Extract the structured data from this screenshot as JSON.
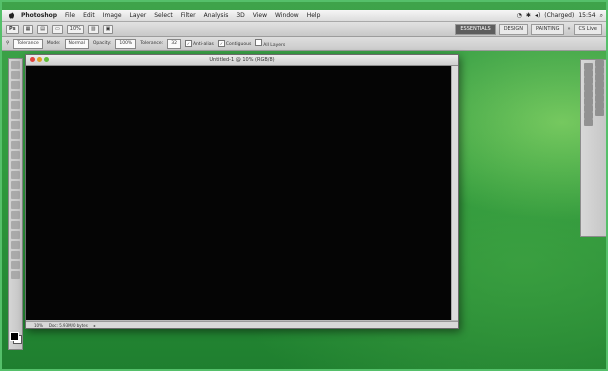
{
  "menubar": {
    "app_name": "Photoshop",
    "items": [
      "File",
      "Edit",
      "Image",
      "Layer",
      "Select",
      "Filter",
      "Analysis",
      "3D",
      "View",
      "Window",
      "Help"
    ],
    "battery": "(Charged)",
    "clock": "15:54"
  },
  "appbar": {
    "zoom": "10%",
    "workspaces": [
      "ESSENTIALS",
      "DESIGN",
      "PAINTING"
    ],
    "more": "»",
    "cs_live": "CS Live"
  },
  "options": {
    "preset": "Tolerance",
    "mode_label": "Mode:",
    "mode_value": "Normal",
    "opacity_label": "Opacity:",
    "opacity_value": "100%",
    "tolerance_label": "Tolerance:",
    "tolerance_value": "32",
    "anti_alias": "Anti-alias",
    "contiguous": "Contiguous",
    "all_layers": "All Layers"
  },
  "document": {
    "title": "Untitled-1 @ 10% (RGB/8)",
    "zoom": "10%",
    "doc_info": "Doc: 5.93M/0 bytes"
  },
  "colors": {
    "canvas": "#050505",
    "desktop": "#2f9a3d"
  }
}
